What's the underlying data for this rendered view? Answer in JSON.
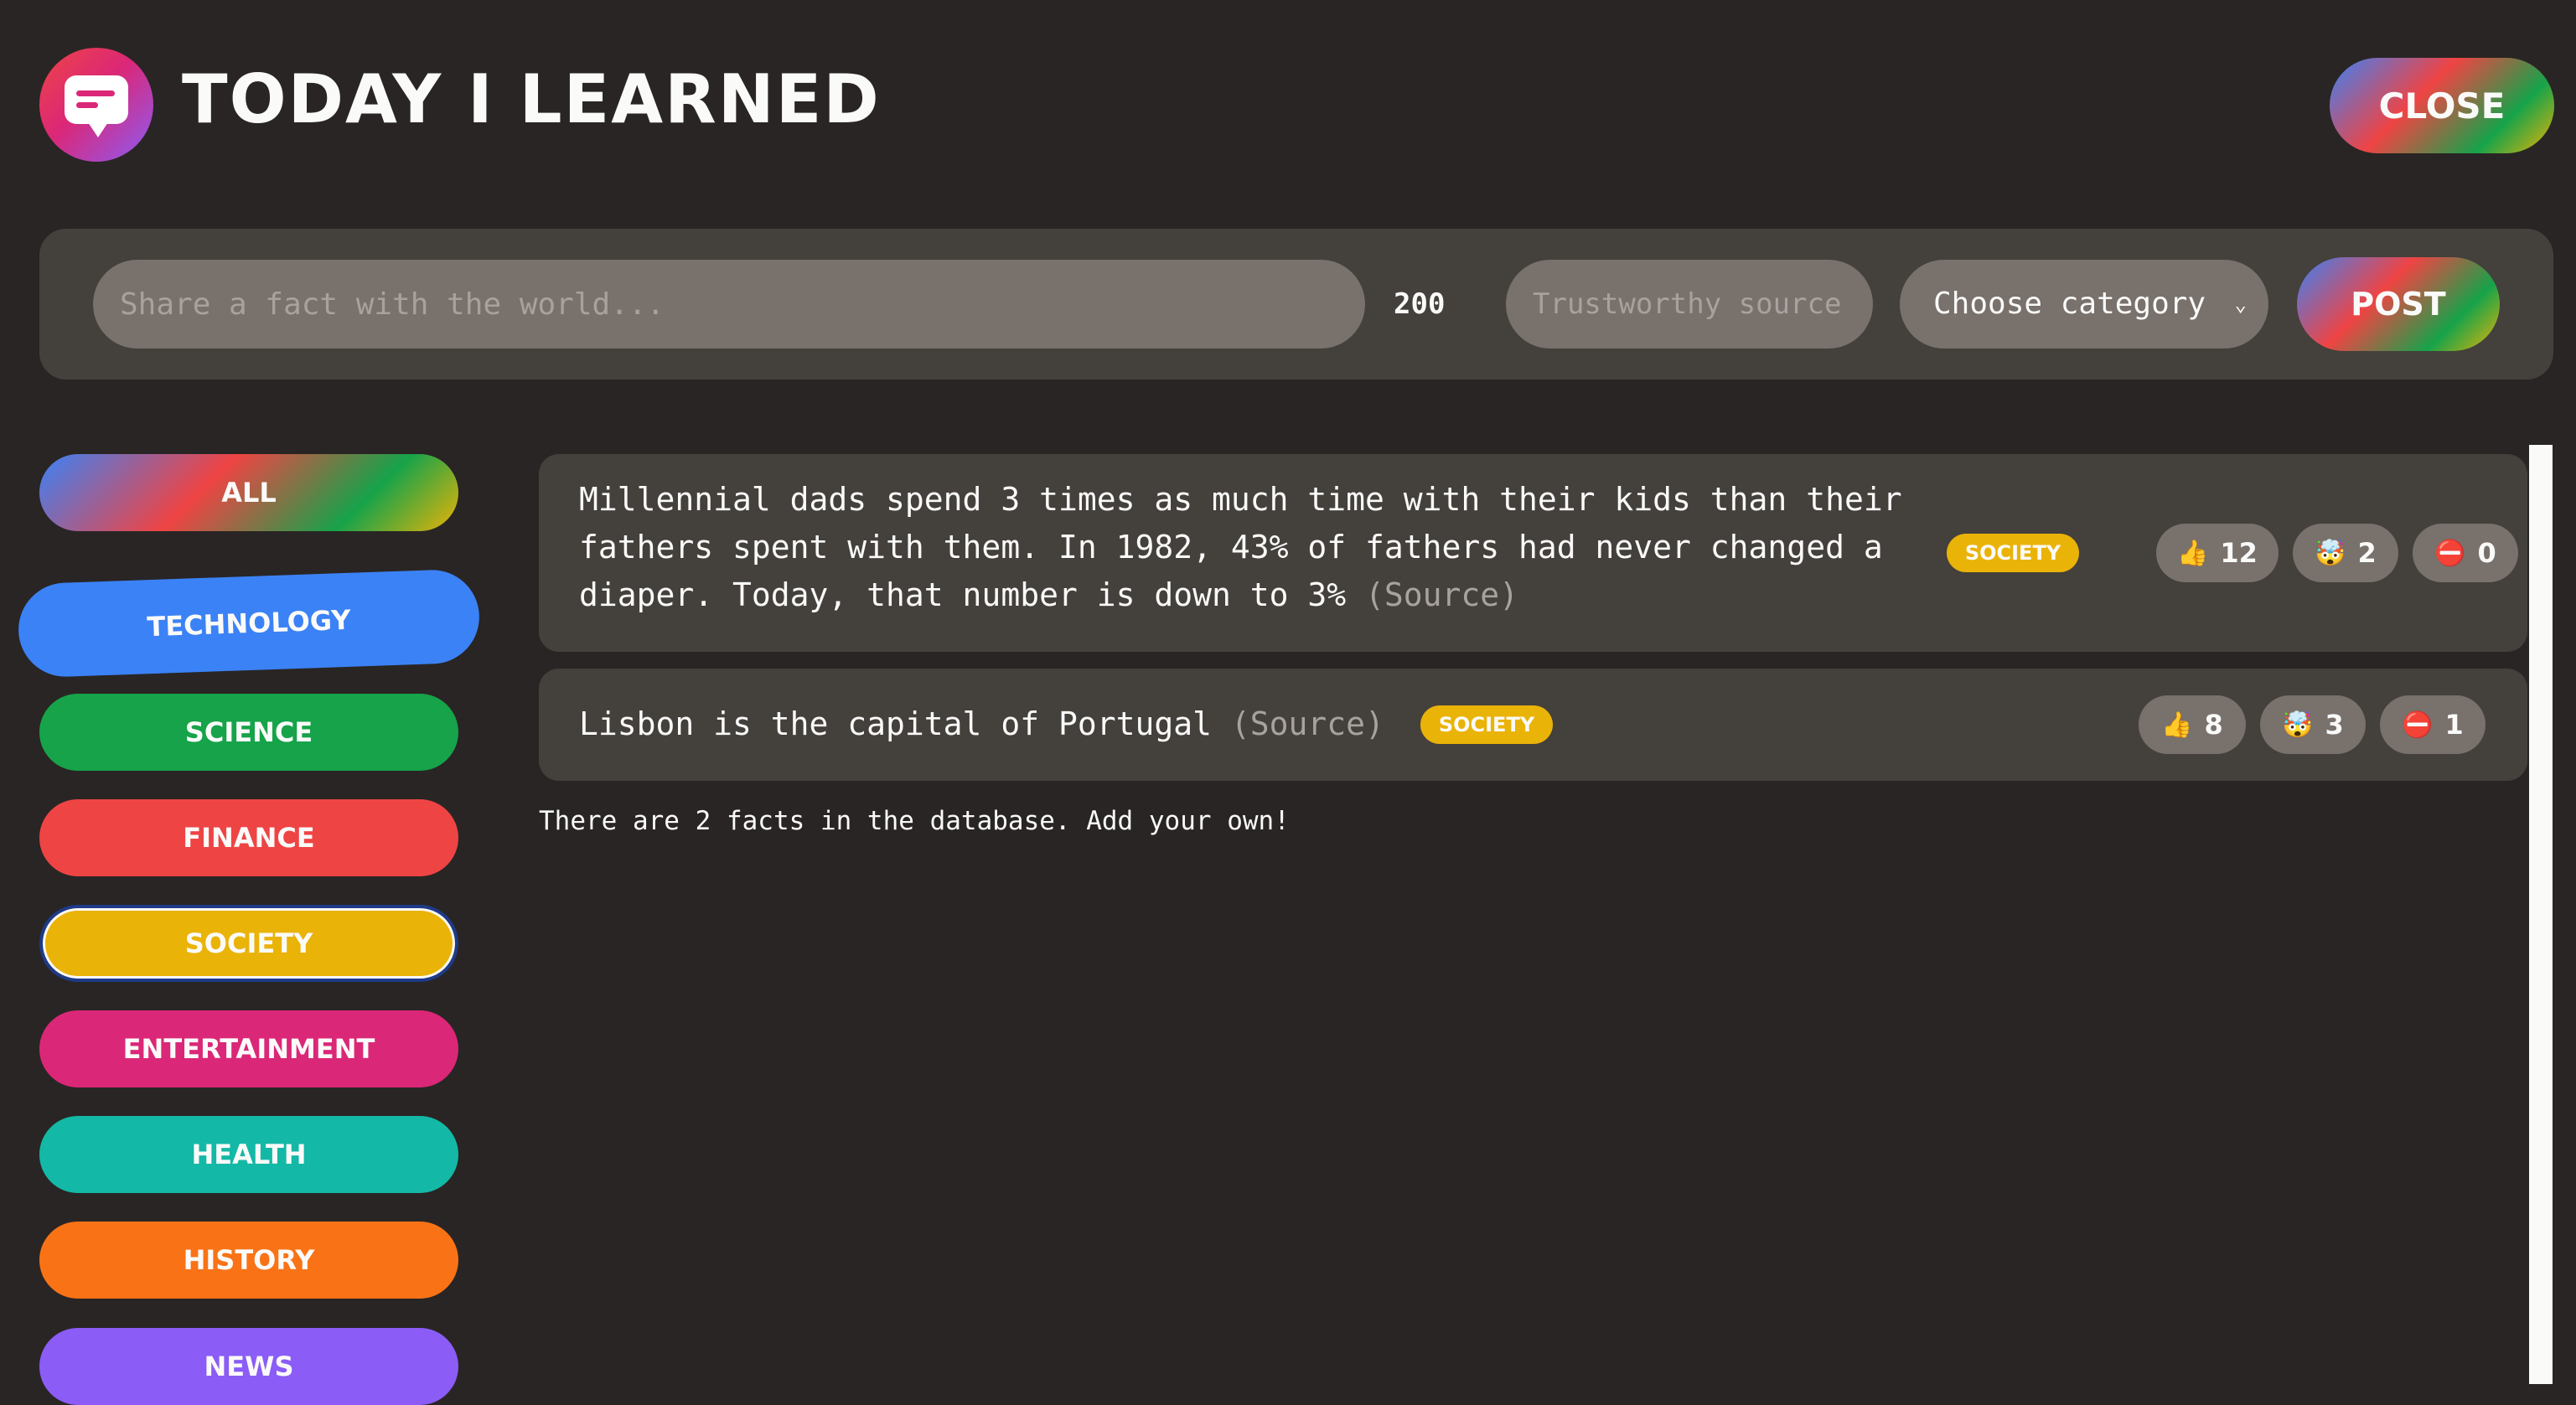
{
  "app": {
    "title": "Today I Learned"
  },
  "header": {
    "close_label": "Close"
  },
  "form": {
    "fact_placeholder": "Share a fact with the world...",
    "char_count": "200",
    "source_placeholder": "Trustworthy source...",
    "category_selected": "Choose category",
    "post_label": "Post"
  },
  "categories": [
    {
      "label": "All",
      "color": "gradient"
    },
    {
      "label": "Technology",
      "color": "#3b82f6"
    },
    {
      "label": "Science",
      "color": "#16a34a"
    },
    {
      "label": "Finance",
      "color": "#ef4444"
    },
    {
      "label": "Society",
      "color": "#eab308"
    },
    {
      "label": "Entertainment",
      "color": "#db2777"
    },
    {
      "label": "Health",
      "color": "#14b8a6"
    },
    {
      "label": "History",
      "color": "#f97316"
    },
    {
      "label": "News",
      "color": "#8b5cf6"
    }
  ],
  "facts": [
    {
      "text": "Millennial dads spend 3 times as much time with their kids than their fathers spent with them. In 1982, 43% of fathers had never changed a diaper. Today, that number is down to 3%",
      "source_label": "(Source)",
      "category": "Society",
      "votes_interesting": "12",
      "votes_mindblowing": "2",
      "votes_false": "0"
    },
    {
      "text": "Lisbon is the capital of Portugal",
      "source_label": "(Source)",
      "category": "Society",
      "votes_interesting": "8",
      "votes_mindblowing": "3",
      "votes_false": "1"
    }
  ],
  "status": {
    "count_text": "There are 2 facts in the database. Add your own!"
  },
  "icons": {
    "interesting": "👍",
    "mindblowing": "🤯",
    "false": "⛔"
  }
}
